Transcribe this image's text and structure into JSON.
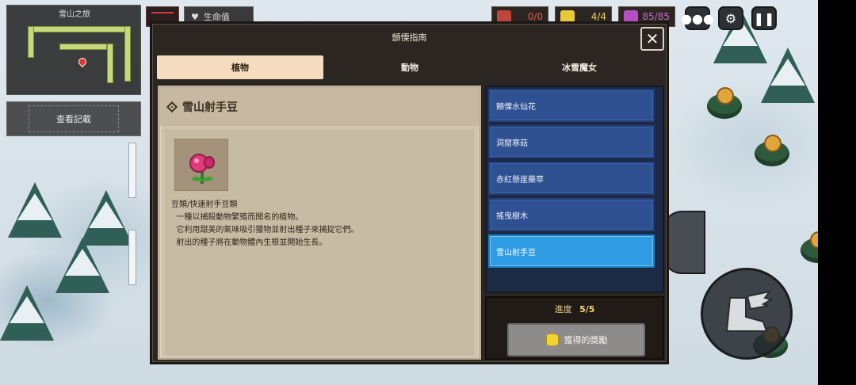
{
  "hud": {
    "minimap_title": "雪山之旅",
    "records_button": "查看記載",
    "life_label": "生命值",
    "stat_1": "0/0",
    "stat_2": "4/4",
    "stat_3": "85/85"
  },
  "modal": {
    "title": "顫慄指南",
    "close_symbol": "✕",
    "tabs": [
      {
        "label": "植物",
        "active": true
      },
      {
        "label": "動物",
        "active": false
      },
      {
        "label": "冰雪魔女",
        "active": false
      }
    ]
  },
  "detail": {
    "name": "雪山射手豆",
    "description": "豆類/快速射手豆類\n  一種以捕殺動物繁殖而聞名的植物。\n  它利用甜美的氣味吸引獵物並射出種子來捕捉它們。\n  射出的種子將在動物體內生根並開始生長。"
  },
  "list": {
    "items": [
      {
        "label": "顫慄水仙花",
        "selected": false
      },
      {
        "label": "洞窟寒菇",
        "selected": false
      },
      {
        "label": "赤紅懸崖藥草",
        "selected": false
      },
      {
        "label": "搖曳樹木",
        "selected": false
      },
      {
        "label": "雪山射手豆",
        "selected": true
      }
    ]
  },
  "progress": {
    "label": "進度",
    "value": "5/5",
    "reward_button": "獲得的獎勵"
  },
  "colors": {
    "accent_tab": "#f5dcbf",
    "list_item": "#2f5192",
    "list_selected": "#2f9be3",
    "progress_text": "#f2d77b"
  }
}
